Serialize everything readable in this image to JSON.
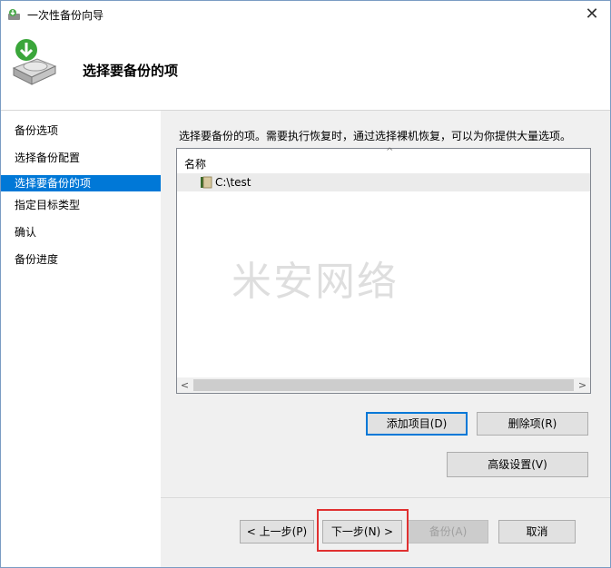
{
  "window": {
    "title": "一次性备份向导",
    "close_glyph": "✕"
  },
  "header": {
    "title": "选择要备份的项"
  },
  "nav": {
    "items": [
      {
        "label": "备份选项",
        "selected": false
      },
      {
        "label": "选择备份配置",
        "selected": false
      },
      {
        "label": "选择要备份的项",
        "selected": true
      },
      {
        "label": "指定目标类型",
        "selected": false
      },
      {
        "label": "确认",
        "selected": false
      },
      {
        "label": "备份进度",
        "selected": false
      }
    ]
  },
  "content": {
    "description": "选择要备份的项。需要执行恢复时，通过选择裸机恢复，可以为你提供大量选项。",
    "list": {
      "column_header": "名称",
      "sort_glyph": "^",
      "rows": [
        {
          "name": "C:\\test",
          "icon": "folder-icon"
        }
      ],
      "scroll_left_glyph": "<",
      "scroll_right_glyph": ">"
    },
    "watermark": "米安网络",
    "buttons": {
      "add": "添加项目(D)",
      "remove": "删除项(R)",
      "advanced": "高级设置(V)"
    }
  },
  "footer": {
    "prev": "< 上一步(P)",
    "next": "下一步(N) >",
    "backup": "备份(A)",
    "cancel": "取消"
  },
  "colors": {
    "selection": "#0078d7",
    "panel_bg": "#f0f0f0",
    "highlight": "#e03030"
  }
}
